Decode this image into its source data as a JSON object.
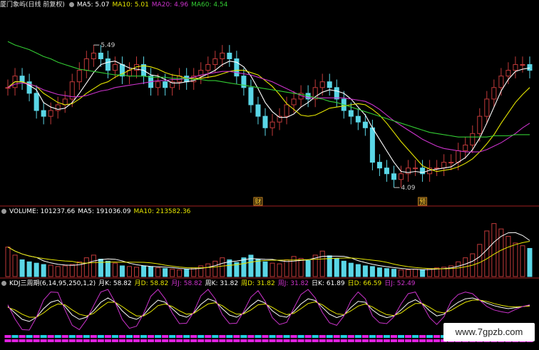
{
  "price_panel": {
    "title": "厦门象屿(日线 前复权)",
    "ma_labels": [
      {
        "text": "MA5: 5.07",
        "color": "#ffffff"
      },
      {
        "text": "MA10: 5.01",
        "color": "#e6e600"
      },
      {
        "text": "MA20: 4.96",
        "color": "#cc33cc"
      },
      {
        "text": "MA60: 4.54",
        "color": "#33cc33"
      }
    ],
    "markers": {
      "high": "5.49",
      "low": "4.09",
      "event1": "财",
      "event2": "预"
    }
  },
  "volume_panel": {
    "labels": [
      {
        "text": "VOLUME: 101237.66",
        "color": "#ffffff"
      },
      {
        "text": "MA5: 191036.09",
        "color": "#ffffff"
      },
      {
        "text": "MA10: 213582.36",
        "color": "#e6e600"
      }
    ]
  },
  "kdj_panel": {
    "labels": [
      {
        "text": "KDJ三周期(6,14,95,250,1,2)",
        "color": "#ffffff"
      },
      {
        "text": "月K: 58.82",
        "color": "#ffffff"
      },
      {
        "text": "月D: 58.82",
        "color": "#e6e600"
      },
      {
        "text": "月J: 58.82",
        "color": "#cc33cc"
      },
      {
        "text": "周K: 31.82",
        "color": "#ffffff"
      },
      {
        "text": "周D: 31.82",
        "color": "#e6e600"
      },
      {
        "text": "周J: 31.82",
        "color": "#cc33cc"
      },
      {
        "text": "日K: 61.89",
        "color": "#ffffff"
      },
      {
        "text": "日D: 66.59",
        "color": "#e6e600"
      },
      {
        "text": "日J: 52.49",
        "color": "#cc33cc"
      }
    ]
  },
  "watermark": "www.7gpzb.com",
  "colors": {
    "up": "#c23a3a",
    "down": "#5ad6e6",
    "ma5": "#ffffff",
    "ma10": "#e6e600",
    "ma20": "#cc33cc",
    "ma60": "#33cc33",
    "divider": "#a02020"
  },
  "chart_data": {
    "type": "candlestick",
    "close": [
      4.95,
      5.05,
      5.0,
      4.9,
      4.75,
      4.7,
      4.75,
      4.8,
      4.85,
      5.0,
      5.1,
      5.2,
      5.25,
      5.2,
      5.1,
      5.15,
      5.05,
      5.1,
      5.15,
      5.05,
      4.95,
      5.0,
      4.95,
      5.0,
      5.05,
      5.0,
      5.05,
      5.1,
      5.15,
      5.2,
      5.25,
      5.2,
      5.05,
      4.95,
      4.8,
      4.7,
      4.6,
      4.65,
      4.7,
      4.8,
      4.85,
      4.9,
      4.85,
      4.95,
      5.0,
      4.95,
      4.85,
      4.75,
      4.7,
      4.65,
      4.6,
      4.3,
      4.25,
      4.2,
      4.15,
      4.2,
      4.25,
      4.25,
      4.2,
      4.25,
      4.25,
      4.3,
      4.3,
      4.4,
      4.45,
      4.55,
      4.7,
      4.85,
      4.95,
      5.05,
      5.1,
      5.15,
      5.15,
      5.1
    ],
    "volume": [
      4.4,
      3.2,
      2.5,
      2.2,
      2.0,
      1.8,
      1.7,
      1.5,
      1.6,
      1.8,
      2.2,
      2.8,
      3.2,
      2.6,
      2.3,
      2.0,
      1.6,
      1.5,
      1.4,
      1.6,
      1.5,
      1.3,
      1.2,
      1.1,
      1.0,
      1.1,
      1.3,
      1.6,
      1.9,
      2.3,
      2.8,
      2.5,
      2.1,
      2.8,
      3.2,
      2.6,
      2.2,
      2.0,
      1.9,
      2.5,
      3.0,
      2.7,
      2.4,
      3.2,
      3.8,
      3.1,
      2.7,
      2.3,
      2.0,
      1.8,
      1.6,
      1.5,
      1.3,
      1.2,
      1.1,
      1.0,
      1.0,
      1.1,
      1.0,
      1.2,
      1.3,
      1.4,
      1.6,
      2.2,
      2.8,
      3.4,
      4.8,
      6.8,
      7.9,
      7.1,
      6.0,
      5.0,
      4.6,
      4.2
    ],
    "series": [
      {
        "name": "MA5",
        "values": [
          4.95,
          5.0,
          5.0,
          4.97,
          4.93,
          4.82,
          4.78,
          4.76,
          4.77,
          4.82,
          4.9,
          4.99,
          5.08,
          5.15,
          5.17,
          5.18,
          5.15,
          5.12,
          5.11,
          5.1,
          5.06,
          5.05,
          5.02,
          4.99,
          4.99,
          5.0,
          5.01,
          5.04,
          5.07,
          5.1,
          5.15,
          5.18,
          5.17,
          5.13,
          5.05,
          4.94,
          4.82,
          4.74,
          4.69,
          4.69,
          4.72,
          4.78,
          4.82,
          4.87,
          4.91,
          4.93,
          4.92,
          4.9,
          4.85,
          4.78,
          4.71,
          4.6,
          4.5,
          4.4,
          4.3,
          4.22,
          4.21,
          4.22,
          4.21,
          4.23,
          4.24,
          4.25,
          4.26,
          4.3,
          4.34,
          4.41,
          4.51,
          4.64,
          4.78,
          4.92,
          5.02,
          5.09,
          5.11,
          5.12
        ]
      },
      {
        "name": "MA10",
        "values": [
          4.95,
          5.0,
          5.0,
          4.98,
          4.96,
          4.9,
          4.86,
          4.82,
          4.8,
          4.81,
          4.85,
          4.9,
          4.94,
          4.98,
          5.0,
          5.04,
          5.07,
          5.1,
          5.13,
          5.14,
          5.13,
          5.11,
          5.08,
          5.06,
          5.05,
          5.03,
          5.03,
          5.03,
          5.04,
          5.05,
          5.07,
          5.09,
          5.1,
          5.1,
          5.08,
          5.06,
          5.01,
          4.96,
          4.89,
          4.81,
          4.76,
          4.71,
          4.7,
          4.71,
          4.74,
          4.77,
          4.78,
          4.79,
          4.8,
          4.81,
          4.8,
          4.76,
          4.71,
          4.64,
          4.56,
          4.48,
          4.41,
          4.34,
          4.27,
          4.24,
          4.22,
          4.23,
          4.24,
          4.26,
          4.29,
          4.33,
          4.39,
          4.46,
          4.54,
          4.64,
          4.73,
          4.82,
          4.89,
          4.95
        ]
      },
      {
        "name": "MA20",
        "values": [
          4.95,
          4.98,
          4.99,
          4.98,
          4.96,
          4.93,
          4.91,
          4.89,
          4.88,
          4.87,
          4.87,
          4.88,
          4.9,
          4.92,
          4.93,
          4.95,
          4.96,
          4.97,
          4.98,
          4.99,
          5.0,
          5.01,
          5.01,
          5.02,
          5.02,
          5.03,
          5.04,
          5.06,
          5.07,
          5.08,
          5.09,
          5.09,
          5.08,
          5.07,
          5.06,
          5.04,
          5.02,
          5.0,
          4.97,
          4.94,
          4.91,
          4.88,
          4.86,
          4.86,
          4.86,
          4.86,
          4.86,
          4.86,
          4.85,
          4.84,
          4.83,
          4.8,
          4.76,
          4.71,
          4.66,
          4.62,
          4.58,
          4.54,
          4.5,
          4.47,
          4.44,
          4.42,
          4.41,
          4.4,
          4.39,
          4.39,
          4.39,
          4.41,
          4.44,
          4.47,
          4.51,
          4.55,
          4.6,
          4.64
        ]
      },
      {
        "name": "MA60",
        "values": [
          5.35,
          5.32,
          5.3,
          5.28,
          5.25,
          5.22,
          5.2,
          5.17,
          5.15,
          5.13,
          5.11,
          5.1,
          5.09,
          5.08,
          5.07,
          5.06,
          5.06,
          5.05,
          5.05,
          5.05,
          5.04,
          5.04,
          5.04,
          5.03,
          5.03,
          5.03,
          5.02,
          5.02,
          5.01,
          5.01,
          5.0,
          4.99,
          4.98,
          4.97,
          4.96,
          4.95,
          4.94,
          4.93,
          4.92,
          4.91,
          4.9,
          4.89,
          4.88,
          4.86,
          4.85,
          4.83,
          4.82,
          4.8,
          4.78,
          4.76,
          4.74,
          4.72,
          4.7,
          4.68,
          4.66,
          4.64,
          4.62,
          4.6,
          4.58,
          4.56,
          4.55,
          4.54,
          4.53,
          4.52,
          4.52,
          4.52,
          4.52,
          4.52,
          4.53,
          4.53,
          4.53,
          4.54,
          4.54,
          4.54
        ]
      }
    ],
    "kdj": [
      {
        "name": "K",
        "values": [
          60,
          45,
          30,
          25,
          35,
          55,
          70,
          75,
          60,
          40,
          30,
          35,
          50,
          70,
          80,
          70,
          50,
          35,
          30,
          40,
          60,
          75,
          70,
          55,
          40,
          35,
          45,
          65,
          78,
          72,
          55,
          40,
          35,
          45,
          62,
          75,
          68,
          50,
          38,
          35,
          48,
          66,
          78,
          74,
          58,
          42,
          34,
          40,
          58,
          72,
          70,
          52,
          40,
          34,
          38,
          52,
          68,
          76,
          66,
          50,
          38,
          42,
          58,
          70,
          78,
          80,
          75,
          68,
          62,
          58,
          55,
          57,
          60,
          62
        ]
      },
      {
        "name": "D",
        "values": [
          58,
          52,
          42,
          35,
          35,
          45,
          58,
          66,
          64,
          52,
          42,
          38,
          44,
          58,
          70,
          70,
          60,
          48,
          38,
          38,
          48,
          62,
          66,
          60,
          50,
          42,
          44,
          55,
          66,
          69,
          62,
          50,
          42,
          43,
          52,
          64,
          66,
          58,
          48,
          41,
          44,
          55,
          67,
          71,
          64,
          52,
          43,
          41,
          50,
          61,
          66,
          59,
          49,
          41,
          39,
          45,
          57,
          67,
          67,
          58,
          48,
          45,
          51,
          61,
          70,
          75,
          75,
          72,
          67,
          63,
          60,
          59,
          60,
          61
        ]
      },
      {
        "name": "J",
        "values": [
          64,
          31,
          6,
          5,
          35,
          75,
          94,
          93,
          52,
          16,
          6,
          29,
          62,
          94,
          100,
          70,
          30,
          9,
          14,
          44,
          84,
          100,
          78,
          45,
          20,
          21,
          47,
          85,
          100,
          78,
          41,
          20,
          21,
          49,
          82,
          97,
          72,
          34,
          18,
          23,
          56,
          88,
          100,
          80,
          46,
          22,
          16,
          38,
          74,
          94,
          78,
          38,
          22,
          20,
          36,
          66,
          90,
          94,
          64,
          34,
          18,
          36,
          72,
          88,
          94,
          90,
          75,
          60,
          52,
          48,
          45,
          53,
          60,
          64
        ]
      }
    ]
  }
}
